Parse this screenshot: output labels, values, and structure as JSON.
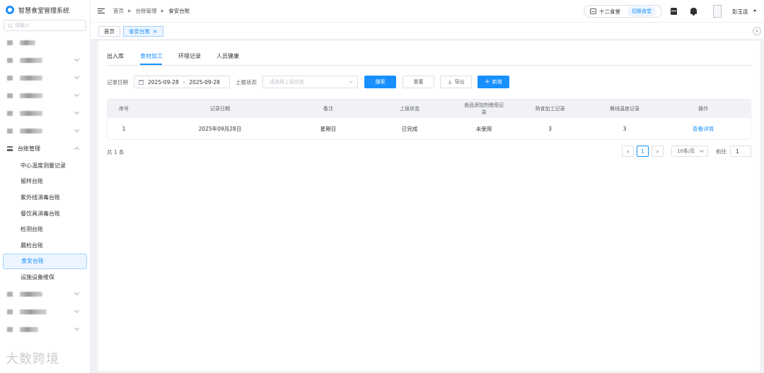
{
  "app": {
    "title": "智慧食堂管理系统"
  },
  "sidebar": {
    "search_placeholder": "请输入",
    "group": {
      "label": "台账管理"
    },
    "sub_items": [
      {
        "label": "中心温度测量记录"
      },
      {
        "label": "留样台账"
      },
      {
        "label": "紫外线消毒台账"
      },
      {
        "label": "餐饮具消毒台账"
      },
      {
        "label": "检测台账"
      },
      {
        "label": "晨检台账"
      },
      {
        "label": "食安台账"
      },
      {
        "label": "设施设备维保"
      }
    ],
    "active_index": 6,
    "watermark": "大数跨境"
  },
  "header": {
    "breadcrumb": [
      "首页",
      "台账管理",
      "食安台账"
    ],
    "canteen_name": "十二食堂",
    "switch_label": "切换食堂",
    "user_name": "彭玉连"
  },
  "tags": [
    {
      "label": "首页"
    },
    {
      "label": "食安台账",
      "close": "×"
    }
  ],
  "tabs": [
    {
      "label": "出入库"
    },
    {
      "label": "食材加工"
    },
    {
      "label": "环境记录"
    },
    {
      "label": "人员健康"
    }
  ],
  "active_tab": 1,
  "filters": {
    "date_label": "记录日期",
    "date_start": "2025-09-28",
    "date_sep": "-",
    "date_end": "2025-09-28",
    "status_label": "上报状态",
    "status_placeholder": "请选择上报状态",
    "search_btn": "搜索",
    "reset_btn": "重置",
    "export_btn": "导出",
    "add_btn": "新增"
  },
  "table": {
    "columns": [
      "序号",
      "记录日期",
      "备注",
      "上报状态",
      "食品添加剂使用记录",
      "熟食加工记录",
      "餐线温度记录",
      "操作"
    ],
    "rows": [
      [
        "1",
        "2025年09月28日",
        "星期日",
        "已完成",
        "未使用",
        "3",
        "3",
        "查看详情"
      ]
    ]
  },
  "pagination": {
    "total": "共 1 条",
    "current_page": "1",
    "page_size": "10条/页",
    "goto_label": "前往",
    "goto_value": "1"
  },
  "colors": {
    "primary": "#1890ff",
    "header_bg": "#f0f2f5"
  }
}
